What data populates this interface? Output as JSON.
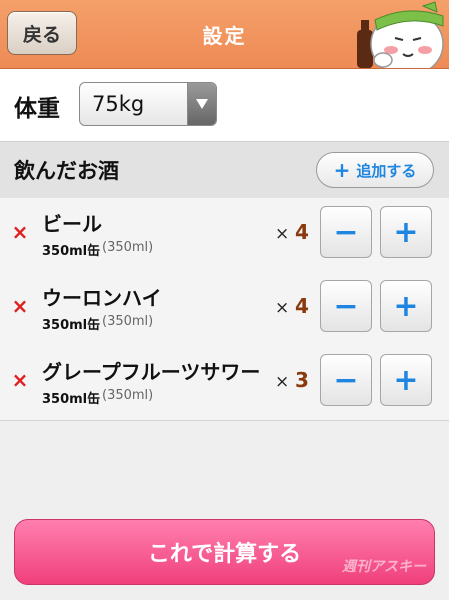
{
  "header": {
    "back_label": "戻る",
    "title": "設定",
    "background": "#ee8a55"
  },
  "weight": {
    "label": "体重",
    "value": "75kg"
  },
  "drinks_section": {
    "title": "飲んだお酒",
    "add_label": "追加する"
  },
  "drinks": [
    {
      "name": "ビール",
      "size": "350ml缶",
      "ml": "(350ml)",
      "times": "×",
      "count": "4"
    },
    {
      "name": "ウーロンハイ",
      "size": "350ml缶",
      "ml": "(350ml)",
      "times": "×",
      "count": "4"
    },
    {
      "name": "グレープフルーツサワー",
      "size": "350ml缶",
      "ml": "(350ml)",
      "times": "×",
      "count": "3"
    }
  ],
  "controls": {
    "minus": "−",
    "plus": "+",
    "remove": "×"
  },
  "calculate_label": "これで計算する",
  "watermark": "週刊アスキー",
  "colors": {
    "accent_blue": "#1e86e0",
    "remove_red": "#e02020",
    "count_brown": "#8b3a10",
    "button_pink": "#f0407c"
  }
}
